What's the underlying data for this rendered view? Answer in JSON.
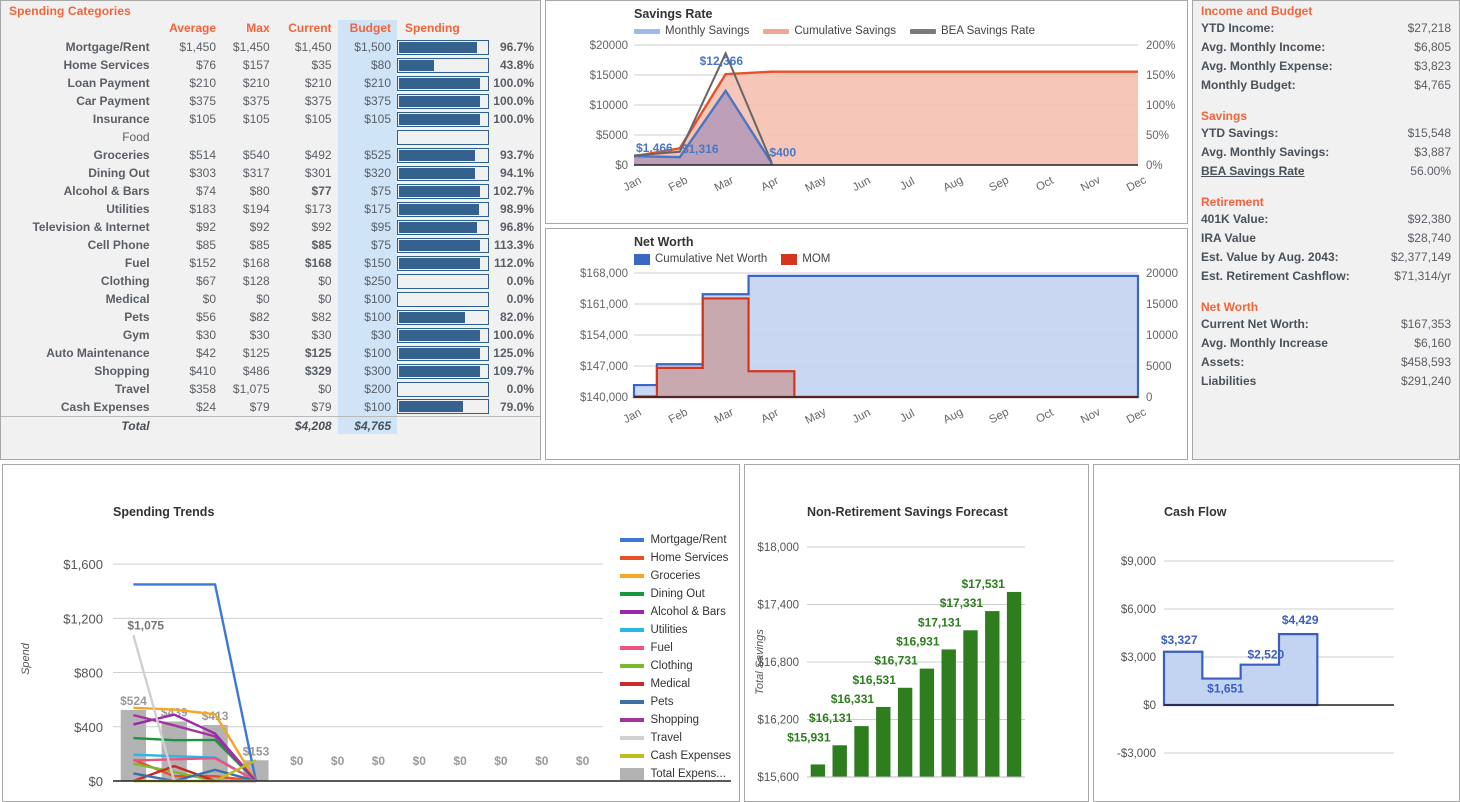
{
  "spending_panel": {
    "title": "Spending Categories",
    "columns": [
      "",
      "Average",
      "Max",
      "Current",
      "Budget",
      "Spending",
      ""
    ],
    "rows": [
      {
        "category": "Mortgage/Rent",
        "indent": 0,
        "average": "$1,450",
        "max": "$1,450",
        "current": "$1,450",
        "budget": "$1,500",
        "pct": "96.7%",
        "pct_value": 96.7,
        "pct_class": "pct-mid",
        "over": false
      },
      {
        "category": "Home Services",
        "indent": 0,
        "average": "$76",
        "max": "$157",
        "current": "$35",
        "budget": "$80",
        "pct": "43.8%",
        "pct_value": 43.8,
        "pct_class": "pct-low",
        "over": false
      },
      {
        "category": "Loan Payment",
        "indent": 0,
        "average": "$210",
        "max": "$210",
        "current": "$210",
        "budget": "$210",
        "pct": "100.0%",
        "pct_value": 100.0,
        "pct_class": "pct-high",
        "over": false
      },
      {
        "category": "Car Payment",
        "indent": 0,
        "average": "$375",
        "max": "$375",
        "current": "$375",
        "budget": "$375",
        "pct": "100.0%",
        "pct_value": 100.0,
        "pct_class": "pct-high",
        "over": false
      },
      {
        "category": "Insurance",
        "indent": 0,
        "average": "$105",
        "max": "$105",
        "current": "$105",
        "budget": "$105",
        "pct": "100.0%",
        "pct_value": 100.0,
        "pct_class": "pct-high",
        "over": false
      },
      {
        "category": "Food",
        "indent": 0,
        "group": true,
        "average": "",
        "max": "",
        "current": "",
        "budget": "",
        "pct": "",
        "pct_value": null,
        "pct_class": "",
        "over": false
      },
      {
        "category": "Groceries",
        "indent": 1,
        "average": "$514",
        "max": "$540",
        "current": "$492",
        "budget": "$525",
        "pct": "93.7%",
        "pct_value": 93.7,
        "pct_class": "pct-mid",
        "over": false
      },
      {
        "category": "Dining Out",
        "indent": 1,
        "average": "$303",
        "max": "$317",
        "current": "$301",
        "budget": "$320",
        "pct": "94.1%",
        "pct_value": 94.1,
        "pct_class": "pct-mid",
        "over": false
      },
      {
        "category": "Alcohol & Bars",
        "indent": 1,
        "average": "$74",
        "max": "$80",
        "current": "$77",
        "budget": "$75",
        "pct": "102.7%",
        "pct_value": 102.7,
        "pct_class": "pct-high",
        "over": true
      },
      {
        "category": "Utilities",
        "indent": 0,
        "average": "$183",
        "max": "$194",
        "current": "$173",
        "budget": "$175",
        "pct": "98.9%",
        "pct_value": 98.9,
        "pct_class": "pct-mid",
        "over": false
      },
      {
        "category": "Television & Internet",
        "indent": 0,
        "average": "$92",
        "max": "$92",
        "current": "$92",
        "budget": "$95",
        "pct": "96.8%",
        "pct_value": 96.8,
        "pct_class": "pct-mid",
        "over": false
      },
      {
        "category": "Cell Phone",
        "indent": 0,
        "average": "$85",
        "max": "$85",
        "current": "$85",
        "budget": "$75",
        "pct": "113.3%",
        "pct_value": 113.3,
        "pct_class": "pct-high",
        "over": true
      },
      {
        "category": "Fuel",
        "indent": 0,
        "average": "$152",
        "max": "$168",
        "current": "$168",
        "budget": "$150",
        "pct": "112.0%",
        "pct_value": 112.0,
        "pct_class": "pct-high",
        "over": true
      },
      {
        "category": "Clothing",
        "indent": 0,
        "average": "$67",
        "max": "$128",
        "current": "$0",
        "budget": "$250",
        "pct": "0.0%",
        "pct_value": 0.0,
        "pct_class": "pct-low",
        "over": false
      },
      {
        "category": "Medical",
        "indent": 0,
        "average": "$0",
        "max": "$0",
        "current": "$0",
        "budget": "$100",
        "pct": "0.0%",
        "pct_value": 0.0,
        "pct_class": "pct-low",
        "over": false
      },
      {
        "category": "Pets",
        "indent": 0,
        "average": "$56",
        "max": "$82",
        "current": "$82",
        "budget": "$100",
        "pct": "82.0%",
        "pct_value": 82.0,
        "pct_class": "pct-mid",
        "over": false
      },
      {
        "category": "Gym",
        "indent": 0,
        "average": "$30",
        "max": "$30",
        "current": "$30",
        "budget": "$30",
        "pct": "100.0%",
        "pct_value": 100.0,
        "pct_class": "pct-high",
        "over": false
      },
      {
        "category": "Auto Maintenance",
        "indent": 0,
        "average": "$42",
        "max": "$125",
        "current": "$125",
        "budget": "$100",
        "pct": "125.0%",
        "pct_value": 125.0,
        "pct_class": "pct-high",
        "over": true
      },
      {
        "category": "Shopping",
        "indent": 0,
        "average": "$410",
        "max": "$486",
        "current": "$329",
        "budget": "$300",
        "pct": "109.7%",
        "pct_value": 109.7,
        "pct_class": "pct-high",
        "over": true
      },
      {
        "category": "Travel",
        "indent": 0,
        "average": "$358",
        "max": "$1,075",
        "current": "$0",
        "budget": "$200",
        "pct": "0.0%",
        "pct_value": 0.0,
        "pct_class": "pct-low",
        "over": false
      },
      {
        "category": "Cash Expenses",
        "indent": 0,
        "average": "$24",
        "max": "$79",
        "current": "$79",
        "budget": "$100",
        "pct": "79.0%",
        "pct_value": 79.0,
        "pct_class": "pct-low",
        "over": false
      }
    ],
    "total": {
      "label": "Total",
      "current": "$4,208",
      "budget": "$4,765"
    }
  },
  "summary_panel": {
    "sections": [
      {
        "heading": "Income and Budget",
        "rows": [
          {
            "label": "YTD Income:",
            "value": "$27,218"
          },
          {
            "label": "Avg. Monthly Income:",
            "value": "$6,805"
          },
          {
            "label": "Avg. Monthly Expense:",
            "value": "$3,823"
          },
          {
            "label": "Monthly Budget:",
            "value": "$4,765"
          }
        ]
      },
      {
        "heading": "Savings",
        "rows": [
          {
            "label": "YTD Savings:",
            "value": "$15,548"
          },
          {
            "label": "Avg. Monthly Savings:",
            "value": "$3,887"
          },
          {
            "label": "BEA Savings Rate",
            "value": "56.00%",
            "link": true
          }
        ]
      },
      {
        "heading": "Retirement",
        "rows": [
          {
            "label": "401K Value:",
            "value": "$92,380"
          },
          {
            "label": "IRA Value",
            "value": "$28,740"
          },
          {
            "label": "Est. Value by Aug. 2043:",
            "value": "$2,377,149"
          },
          {
            "label": "Est. Retirement Cashflow:",
            "value": "$71,314/yr"
          }
        ]
      },
      {
        "heading": "Net Worth",
        "rows": [
          {
            "label": "Current Net Worth:",
            "value": "$167,353"
          },
          {
            "label": "Avg. Monthly Increase",
            "value": "$6,160"
          },
          {
            "label": "Assets:",
            "value": "$458,593"
          },
          {
            "label": "Liabilities",
            "value": "$291,240"
          }
        ]
      }
    ]
  },
  "chart_data": [
    {
      "id": "savings_rate",
      "type": "area",
      "title": "Savings Rate",
      "categories": [
        "Jan",
        "Feb",
        "Mar",
        "Apr",
        "May",
        "Jun",
        "Jul",
        "Aug",
        "Sep",
        "Oct",
        "Nov",
        "Dec"
      ],
      "ylabel": "",
      "xlabel": "",
      "ylim": [
        0,
        20000
      ],
      "yticks": [
        "$0",
        "$5000",
        "$10000",
        "$15000",
        "$20000"
      ],
      "y2lim": [
        0,
        200
      ],
      "y2ticks": [
        "0%",
        "50%",
        "100%",
        "150%",
        "200%"
      ],
      "legend_position": "top",
      "grid": true,
      "series": [
        {
          "name": "Monthly Savings",
          "color": "#4a77c4",
          "values": [
            1466,
            1316,
            12366,
            400,
            null,
            null,
            null,
            null,
            null,
            null,
            null,
            null
          ],
          "labels": [
            "$1,466",
            "$1,316",
            "$12,366",
            "$400",
            "",
            "",
            "",
            "",
            "",
            "",
            "",
            ""
          ]
        },
        {
          "name": "Cumulative Savings",
          "color": "#e8502a",
          "values": [
            1466,
            2782,
            15148,
            15548,
            15548,
            15548,
            15548,
            15548,
            15548,
            15548,
            15548,
            15548
          ]
        },
        {
          "name": "BEA Savings Rate",
          "color": "#666666",
          "axis": "right",
          "values": [
            16,
            22,
            186,
            5,
            null,
            null,
            null,
            null,
            null,
            null,
            null,
            null
          ]
        }
      ]
    },
    {
      "id": "net_worth",
      "type": "area",
      "title": "Net Worth",
      "categories": [
        "Jan",
        "Feb",
        "Mar",
        "Apr",
        "May",
        "Jun",
        "Jul",
        "Aug",
        "Sep",
        "Oct",
        "Nov",
        "Dec"
      ],
      "ylim": [
        140000,
        168000
      ],
      "yticks": [
        "$140,000",
        "$147,000",
        "$154,000",
        "$161,000",
        "$168,000"
      ],
      "y2lim": [
        0,
        20000
      ],
      "y2ticks": [
        "0",
        "5000",
        "10000",
        "15000",
        "20000"
      ],
      "legend_position": "top",
      "grid": true,
      "series": [
        {
          "name": "Cumulative Net Worth",
          "color": "#3a66c4",
          "values": [
            142700,
            147400,
            163200,
            167353,
            167353,
            167353,
            167353,
            167353,
            167353,
            167353,
            167353,
            167353
          ]
        },
        {
          "name": "MOM",
          "color": "#d6341c",
          "axis": "right",
          "values": [
            90,
            4700,
            15900,
            4153,
            0,
            0,
            0,
            0,
            0,
            0,
            0,
            0
          ]
        }
      ]
    },
    {
      "id": "spending_trends",
      "type": "line",
      "title": "Spending Trends",
      "ylabel": "Spend",
      "xlabel": "",
      "ylim": [
        0,
        1800
      ],
      "yticks": [
        "$0",
        "$400",
        "$800",
        "$1,200",
        "$1,600"
      ],
      "grid": true,
      "legend_position": "right",
      "bar_series": {
        "name": "Total Expens...",
        "color": "#b3b3b3",
        "values": [
          524,
          439,
          413,
          153,
          0,
          0,
          0,
          0,
          0,
          0,
          0,
          0
        ],
        "labels": [
          "$524",
          "$439",
          "$413",
          "$153",
          "$0",
          "$0",
          "$0",
          "$0",
          "$0",
          "$0",
          "$0",
          "$0"
        ]
      },
      "series": [
        {
          "name": "Mortgage/Rent",
          "color": "#3b78d8",
          "values": [
            1450,
            1450,
            1450,
            0
          ]
        },
        {
          "name": "Home Services",
          "color": "#e8502a",
          "values": [
            157,
            35,
            35,
            0
          ]
        },
        {
          "name": "Groceries",
          "color": "#f5a623",
          "values": [
            540,
            527,
            492,
            0
          ]
        },
        {
          "name": "Dining Out",
          "color": "#1a9641",
          "values": [
            317,
            301,
            303,
            0
          ]
        },
        {
          "name": "Alcohol & Bars",
          "color": "#9b27af",
          "values": [
            417,
            490,
            350,
            0
          ]
        },
        {
          "name": "Utilities",
          "color": "#29b6e8",
          "values": [
            194,
            183,
            173,
            0
          ]
        },
        {
          "name": "Fuel",
          "color": "#f0527f",
          "values": [
            152,
            160,
            168,
            0
          ]
        },
        {
          "name": "Clothing",
          "color": "#7cb82f",
          "values": [
            128,
            67,
            0,
            0
          ]
        },
        {
          "name": "Medical",
          "color": "#cc2a2a",
          "values": [
            0,
            110,
            0,
            0
          ]
        },
        {
          "name": "Pets",
          "color": "#3b6fa8",
          "values": [
            56,
            0,
            82,
            0
          ]
        },
        {
          "name": "Shopping",
          "color": "#a0359b",
          "values": [
            486,
            410,
            329,
            0
          ]
        },
        {
          "name": "Travel",
          "color": "#d0d0d0",
          "values": [
            1075,
            0,
            0,
            0
          ],
          "labels": [
            "$1,075"
          ]
        },
        {
          "name": "Cash Expenses",
          "color": "#bdbd20",
          "values": [
            0,
            0,
            0,
            153
          ]
        }
      ]
    },
    {
      "id": "savings_forecast",
      "type": "bar",
      "title": "Non-Retirement Savings Forecast",
      "ylabel": "Total Savings",
      "ylim": [
        15600,
        18000
      ],
      "yticks": [
        "$15,600",
        "$16,200",
        "$16,800",
        "$17,400",
        "$18,000"
      ],
      "bar_color": "#2e7d1f",
      "grid": true,
      "values": [
        15731,
        15931,
        16131,
        16331,
        16531,
        16731,
        16931,
        17131,
        17331,
        17531
      ],
      "labels": [
        "",
        "$15,931",
        "$16,131",
        "$16,331",
        "$16,531",
        "$16,731",
        "$16,931",
        "$17,131",
        "$17,331",
        "$17,531"
      ]
    },
    {
      "id": "cash_flow",
      "type": "area",
      "title": "Cash Flow",
      "ylim": [
        -4500,
        10500
      ],
      "yticks": [
        "-$3,000",
        "$0",
        "$3,000",
        "$6,000",
        "$9,000"
      ],
      "line_color": "#3b5fc0",
      "fill_color": "#c3d3f2",
      "grid": true,
      "values": [
        3327,
        1651,
        2520,
        4429
      ],
      "labels": [
        "$3,327",
        "$1,651",
        "$2,520",
        "$4,429"
      ]
    }
  ],
  "colors": {
    "accent_orange": "#f4633a",
    "bar_blue": "#35618f",
    "budget_col": "#cfe4f7",
    "over_red": "#c0392b"
  }
}
